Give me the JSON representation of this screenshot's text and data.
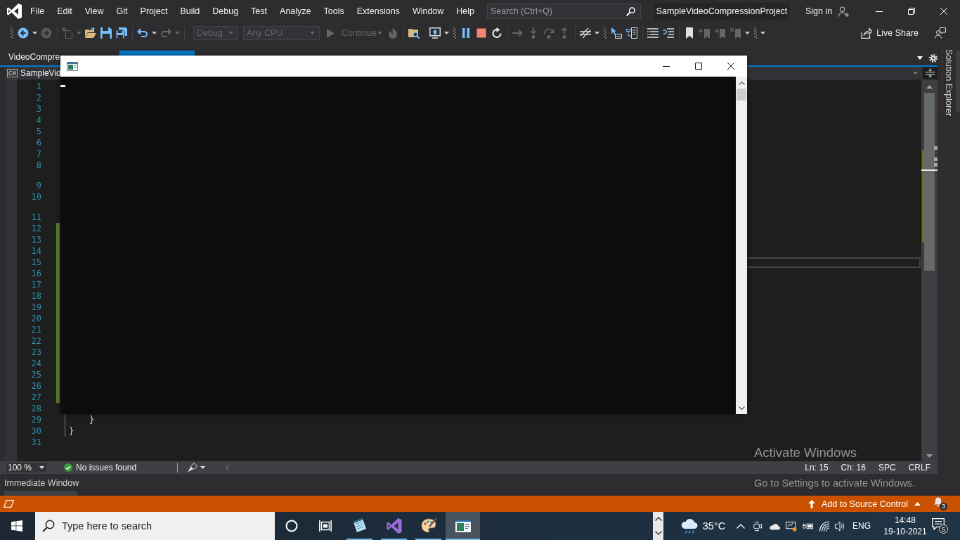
{
  "title_bar": {
    "menu": [
      "File",
      "Edit",
      "View",
      "Git",
      "Project",
      "Build",
      "Debug",
      "Test",
      "Analyze",
      "Tools",
      "Extensions",
      "Window",
      "Help"
    ],
    "search": {
      "placeholder": "Search (Ctrl+Q)"
    },
    "solution_name": "SampleVideoCompressionProject",
    "sign_in": "Sign in"
  },
  "toolbar": {
    "configuration": {
      "value": "Debug",
      "disabled": true
    },
    "platform": {
      "value": "Any CPU",
      "disabled": true
    },
    "continue": {
      "label": "Continue",
      "disabled": true
    },
    "live_share": "Live Share"
  },
  "document_tabs": [
    {
      "label": "VideoCompre",
      "selected": false
    },
    {
      "selected": true
    }
  ],
  "navigation_bar": {
    "badge": "C#",
    "project": "SampleVid"
  },
  "editor": {
    "lines": [
      {
        "number": "1",
        "gap_above": false,
        "changed": false
      },
      {
        "number": "2",
        "gap_above": false,
        "changed": false
      },
      {
        "number": "3",
        "gap_above": false,
        "changed": false
      },
      {
        "number": "4",
        "gap_above": false,
        "changed": false
      },
      {
        "number": "5",
        "gap_above": false,
        "changed": false
      },
      {
        "number": "6",
        "gap_above": false,
        "changed": false
      },
      {
        "number": "7",
        "gap_above": false,
        "changed": false
      },
      {
        "number": "8",
        "gap_above": false,
        "changed": false
      },
      {
        "number": "9",
        "gap_above": true,
        "changed": false
      },
      {
        "number": "10",
        "gap_above": false,
        "changed": false
      },
      {
        "number": "11",
        "gap_above": true,
        "changed": false
      },
      {
        "number": "12",
        "gap_above": false,
        "changed": true
      },
      {
        "number": "13",
        "gap_above": false,
        "changed": true
      },
      {
        "number": "14",
        "gap_above": false,
        "changed": true
      },
      {
        "number": "15",
        "gap_above": false,
        "changed": true
      },
      {
        "number": "16",
        "gap_above": false,
        "changed": true
      },
      {
        "number": "17",
        "gap_above": false,
        "changed": true
      },
      {
        "number": "18",
        "gap_above": false,
        "changed": true
      },
      {
        "number": "19",
        "gap_above": false,
        "changed": true
      },
      {
        "number": "20",
        "gap_above": false,
        "changed": true
      },
      {
        "number": "21",
        "gap_above": false,
        "changed": true
      },
      {
        "number": "22",
        "gap_above": false,
        "changed": true
      },
      {
        "number": "23",
        "gap_above": false,
        "changed": true
      },
      {
        "number": "24",
        "gap_above": false,
        "changed": true
      },
      {
        "number": "25",
        "gap_above": false,
        "changed": true
      },
      {
        "number": "26",
        "gap_above": false,
        "changed": true
      },
      {
        "number": "27",
        "gap_above": false,
        "changed": true
      },
      {
        "number": "28",
        "gap_above": false,
        "changed": false
      },
      {
        "number": "29",
        "gap_above": false,
        "changed": false,
        "code": "    }"
      },
      {
        "number": "30",
        "gap_above": false,
        "changed": false,
        "code": "}"
      },
      {
        "number": "31",
        "gap_above": false,
        "changed": false
      }
    ]
  },
  "editor_status": {
    "zoom": "100 %",
    "issues": "No issues found",
    "line": "Ln: 15",
    "column": "Ch: 16",
    "indent": "SPC",
    "line_ending": "CRLF"
  },
  "side_dock": {
    "tab": "Solution Explorer"
  },
  "bottom_panel": {
    "title": "Immediate Window"
  },
  "status_bar": {
    "source_control": "Add to Source Control",
    "notifications": "3"
  },
  "activation_notice": {
    "title": "Activate Windows",
    "message": "Go to Settings to activate Windows."
  },
  "taskbar": {
    "search": {
      "placeholder": "Type here to search"
    },
    "apps": [
      {
        "kind": "notepad",
        "running": true,
        "selected": false
      },
      {
        "kind": "studio",
        "running": true,
        "selected": false
      },
      {
        "kind": "paint",
        "running": true,
        "selected": false
      },
      {
        "kind": "console",
        "running": true,
        "selected": true
      }
    ],
    "temperature": "35°C",
    "language": "ENG",
    "time": "14:48",
    "date": "19-10-2021",
    "notifications": "5"
  }
}
